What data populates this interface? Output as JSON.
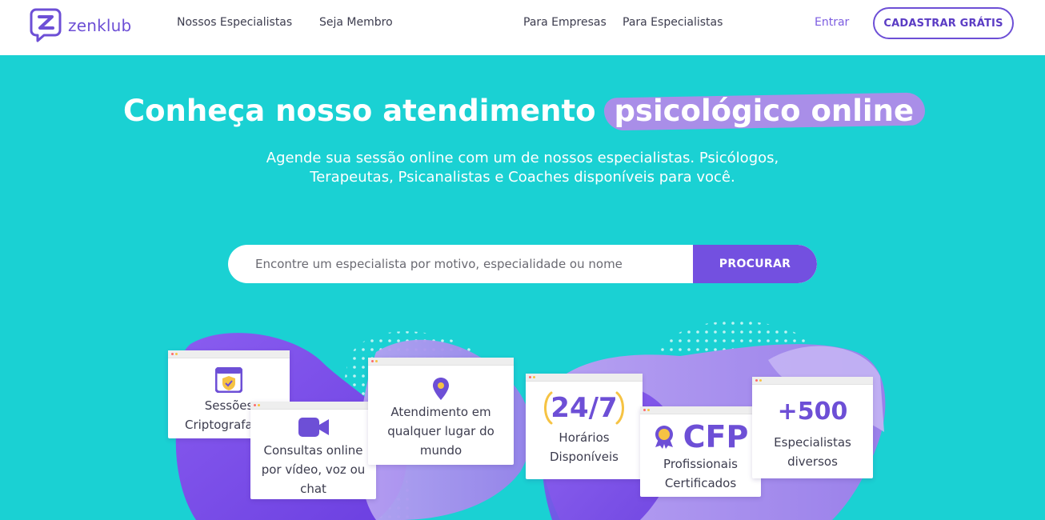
{
  "header": {
    "logo_text": "zenklub",
    "nav": {
      "specialists": "Nossos Especialistas",
      "member": "Seja Membro",
      "companies": "Para Empresas",
      "for_specialists": "Para Especialistas",
      "login": "Entrar",
      "signup": "CADASTRAR GRÁTIS"
    }
  },
  "hero": {
    "title_prefix": "Conheça nosso atendimento",
    "title_highlight": "psicológico online",
    "subtitle": "Agende sua sessão online com um de nossos especialistas. Psicólogos, Terapeutas, Psicanalistas e Coaches disponíveis para você."
  },
  "search": {
    "placeholder": "Encontre um especialista por motivo, especialidade ou nome",
    "button": "PROCURAR"
  },
  "features": {
    "encrypted": "Sessões Criptografadas",
    "video": "Consultas online por vídeo, voz ou chat",
    "anywhere": "Atendimento em qualquer lugar do mundo",
    "hours_big": "24/7",
    "hours": "Horários Disponíveis",
    "cfp_big": "CFP",
    "cfp": "Profissionais Certificados",
    "specialists_big": "+500",
    "specialists": "Especialistas diversos"
  },
  "colors": {
    "brand": "#6d4fd6",
    "background": "#1ad1d3",
    "button": "#7350e0",
    "highlight": "#a98ee8"
  },
  "icons": [
    "zenklub-logo-icon",
    "shield-check-icon",
    "video-camera-icon",
    "map-pin-icon",
    "laurel-icon",
    "certificate-medal-icon"
  ]
}
